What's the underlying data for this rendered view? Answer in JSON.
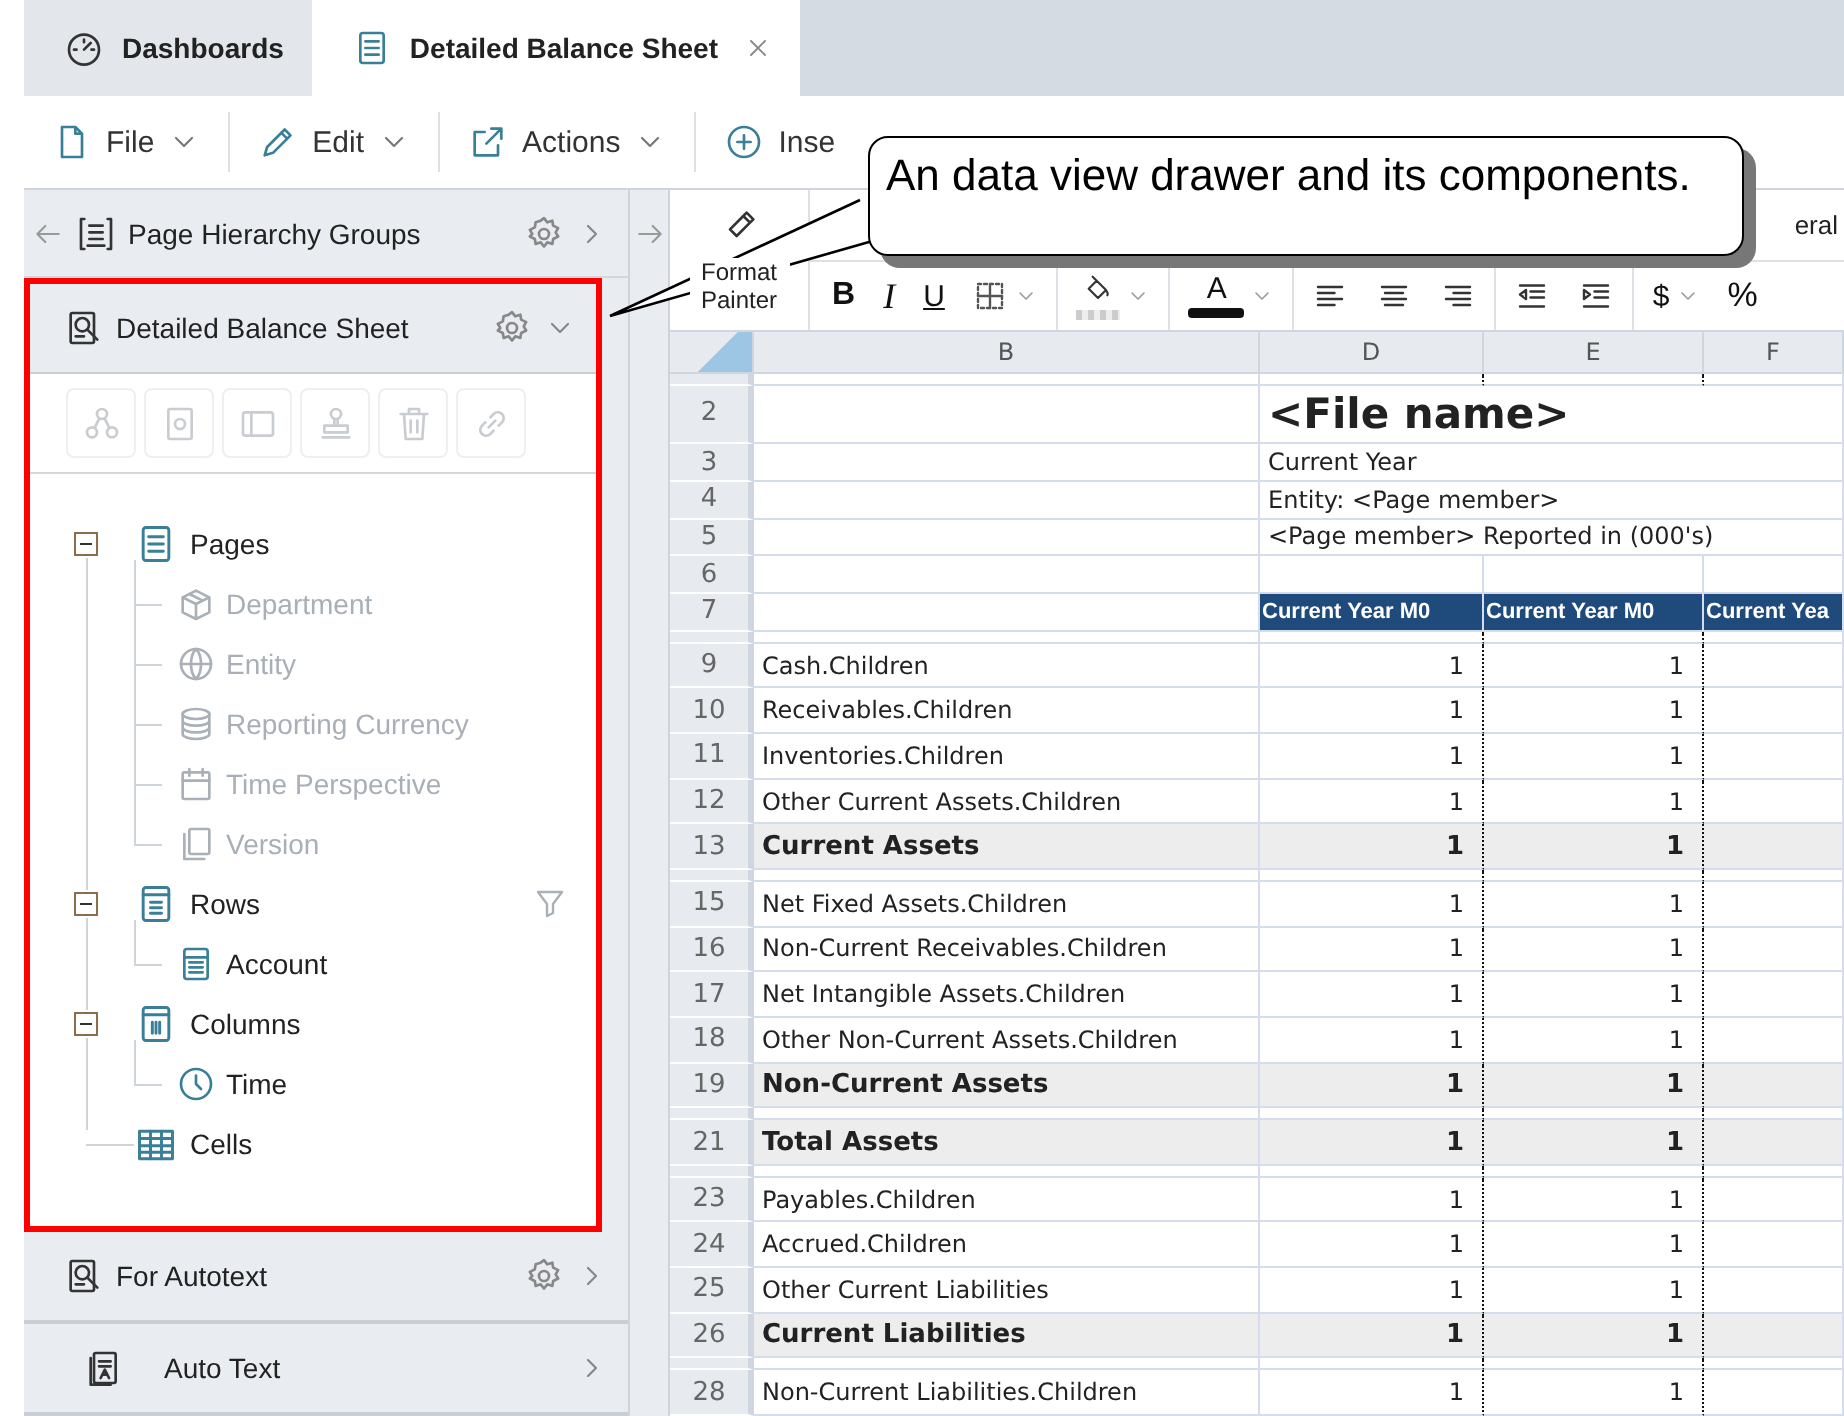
{
  "tabs": [
    {
      "label": "Dashboards",
      "selected": false,
      "closable": false
    },
    {
      "label": "Detailed Balance Sheet",
      "selected": true,
      "closable": true
    }
  ],
  "menus": [
    {
      "label": "File"
    },
    {
      "label": "Edit"
    },
    {
      "label": "Actions"
    },
    {
      "label": "Inse"
    }
  ],
  "callout": {
    "text": "An data view drawer and its components."
  },
  "sidebar": {
    "groups_title": "Page Hierarchy Groups",
    "panels": [
      {
        "title": "Detailed Balance Sheet",
        "expanded": true,
        "settings": true,
        "highlighted": true
      },
      {
        "title": "For Autotext",
        "expanded": false,
        "settings": true,
        "highlighted": false
      },
      {
        "title": "Auto Text",
        "expanded": false,
        "settings": false,
        "highlighted": false
      }
    ],
    "tools": [
      {
        "disabled": true
      },
      {
        "disabled": true
      },
      {
        "disabled": true
      },
      {
        "disabled": true
      },
      {
        "disabled": true
      },
      {
        "disabled": true
      }
    ],
    "tree": [
      {
        "label": "Pages",
        "expanded": true,
        "filtered": false,
        "disabled": false,
        "children": [
          {
            "label": "Department",
            "disabled": true
          },
          {
            "label": "Entity",
            "disabled": true
          },
          {
            "label": "Reporting Currency",
            "disabled": true
          },
          {
            "label": "Time Perspective",
            "disabled": true
          },
          {
            "label": "Version",
            "disabled": true
          }
        ]
      },
      {
        "label": "Rows",
        "expanded": true,
        "filtered": true,
        "disabled": false,
        "children": [
          {
            "label": "Account",
            "disabled": false
          }
        ]
      },
      {
        "label": "Columns",
        "expanded": true,
        "filtered": false,
        "disabled": false,
        "children": [
          {
            "label": "Time",
            "disabled": false
          }
        ]
      },
      {
        "label": "Cells",
        "filtered": false,
        "disabled": false
      }
    ]
  },
  "sheet": {
    "format_painter": "Format Painter",
    "number_format": "eral",
    "format_buttons": [
      {
        "kind": "bold",
        "label": "B"
      },
      {
        "kind": "italic",
        "label": "I"
      },
      {
        "kind": "underline",
        "label": "U"
      },
      {
        "kind": "borders"
      },
      {
        "kind": "fill"
      },
      {
        "kind": "fontcolor",
        "label": "A"
      },
      {
        "kind": "alignleft"
      },
      {
        "kind": "aligncenter"
      },
      {
        "kind": "alignright"
      },
      {
        "kind": "outdent"
      },
      {
        "kind": "indent"
      },
      {
        "kind": "currency",
        "label": "$"
      },
      {
        "kind": "percent",
        "label": "%"
      }
    ],
    "columns": [
      "B",
      "D",
      "E",
      "F"
    ],
    "rows": [
      {
        "kind": "gap"
      },
      {
        "kind": "title",
        "number": "2",
        "text": "<File name>"
      },
      {
        "kind": "text",
        "number": "3",
        "text": "Current Year"
      },
      {
        "kind": "text",
        "number": "4",
        "text": "Entity: <Page member>"
      },
      {
        "kind": "text",
        "number": "5",
        "text": "<Page member> Reported in (000's)"
      },
      {
        "kind": "blank",
        "number": "6"
      },
      {
        "kind": "header",
        "number": "7",
        "headers": [
          "Current Year M0",
          "Current Year M0",
          "Current Yea"
        ]
      },
      {
        "kind": "gap"
      },
      {
        "kind": "data",
        "number": "9",
        "label": "Cash.Children",
        "values": [
          "1",
          "1"
        ]
      },
      {
        "kind": "data",
        "number": "10",
        "label": "Receivables.Children",
        "values": [
          "1",
          "1"
        ]
      },
      {
        "kind": "data",
        "number": "11",
        "label": "Inventories.Children",
        "values": [
          "1",
          "1"
        ]
      },
      {
        "kind": "data",
        "number": "12",
        "label": "Other Current Assets.Children",
        "values": [
          "1",
          "1"
        ]
      },
      {
        "kind": "total",
        "number": "13",
        "label": "Current Assets",
        "values": [
          "1",
          "1"
        ]
      },
      {
        "kind": "gap"
      },
      {
        "kind": "data",
        "number": "15",
        "label": "Net Fixed Assets.Children",
        "values": [
          "1",
          "1"
        ]
      },
      {
        "kind": "data",
        "number": "16",
        "label": "Non-Current Receivables.Children",
        "values": [
          "1",
          "1"
        ]
      },
      {
        "kind": "data",
        "number": "17",
        "label": "Net Intangible Assets.Children",
        "values": [
          "1",
          "1"
        ]
      },
      {
        "kind": "data",
        "number": "18",
        "label": "Other Non-Current Assets.Children",
        "values": [
          "1",
          "1"
        ]
      },
      {
        "kind": "total",
        "number": "19",
        "label": "Non-Current Assets",
        "values": [
          "1",
          "1"
        ]
      },
      {
        "kind": "gap"
      },
      {
        "kind": "total",
        "number": "21",
        "label": "Total Assets",
        "values": [
          "1",
          "1"
        ]
      },
      {
        "kind": "gap"
      },
      {
        "kind": "data",
        "number": "23",
        "label": "Payables.Children",
        "values": [
          "1",
          "1"
        ]
      },
      {
        "kind": "data",
        "number": "24",
        "label": "Accrued.Children",
        "values": [
          "1",
          "1"
        ]
      },
      {
        "kind": "data",
        "number": "25",
        "label": "Other Current Liabilities",
        "values": [
          "1",
          "1"
        ]
      },
      {
        "kind": "total",
        "number": "26",
        "label": "Current Liabilities",
        "values": [
          "1",
          "1"
        ]
      },
      {
        "kind": "gap"
      },
      {
        "kind": "data",
        "number": "28",
        "label": "Non-Current Liabilities.Children",
        "values": [
          "1",
          "1"
        ]
      }
    ]
  }
}
